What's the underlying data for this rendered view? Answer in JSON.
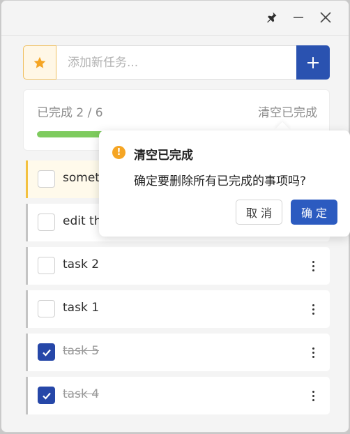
{
  "titlebar": {
    "icons": [
      "pin-icon",
      "minimize-icon",
      "close-icon"
    ]
  },
  "input": {
    "placeholder": "添加新任务...",
    "value": "",
    "star_icon": "star-icon",
    "add_icon": "plus-icon"
  },
  "progress": {
    "label": "已完成 2 / 6",
    "clear_label": "清空已完成",
    "completed": 2,
    "total": 6,
    "fill_color": "#7ecb5e"
  },
  "tasks": [
    {
      "label": "something",
      "done": false,
      "highlight": true
    },
    {
      "label": "edit this",
      "done": false,
      "highlight": false
    },
    {
      "label": "task 2",
      "done": false,
      "highlight": false
    },
    {
      "label": "task 1",
      "done": false,
      "highlight": false
    },
    {
      "label": "task 5",
      "done": true,
      "highlight": false
    },
    {
      "label": "task 4",
      "done": true,
      "highlight": false
    }
  ],
  "popconfirm": {
    "title": "清空已完成",
    "message": "确定要删除所有已完成的事项吗?",
    "cancel_label": "取 消",
    "ok_label": "确 定",
    "icon": "warning-icon"
  },
  "colors": {
    "accent": "#2a52b0",
    "star": "#f5a524",
    "highlight_border": "#f3c140"
  }
}
